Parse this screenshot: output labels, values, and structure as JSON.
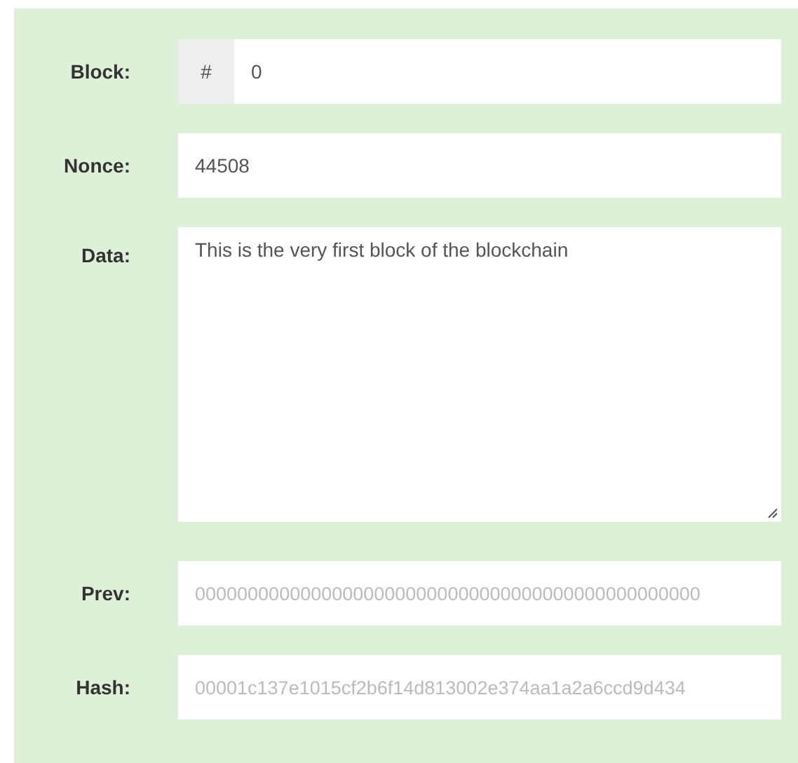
{
  "fields": [
    {
      "label": "Block:",
      "kind": "prefixed",
      "prefix": "#",
      "value": "0",
      "disabled": false
    },
    {
      "label": "Nonce:",
      "kind": "text",
      "value": "44508",
      "disabled": false
    },
    {
      "label": "Data:",
      "kind": "textarea",
      "value": "This is the very first block of the blockchain",
      "disabled": false
    },
    {
      "label": "Prev:",
      "kind": "text",
      "value": "000000000000000000000000000000000000000000000000",
      "disabled": true
    },
    {
      "label": "Hash:",
      "kind": "text",
      "value": "00001c137e1015cf2b6f14d813002e374aa1a2a6ccd9d434",
      "disabled": true
    }
  ]
}
